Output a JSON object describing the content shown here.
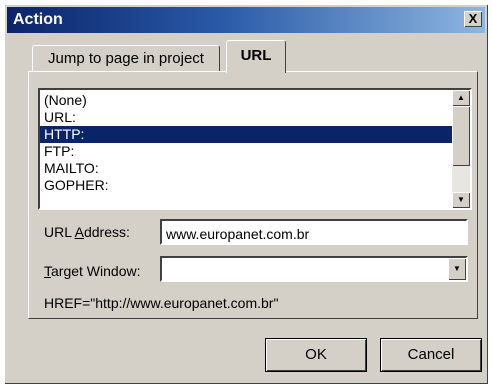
{
  "window": {
    "title": "Action",
    "close_glyph": "X"
  },
  "tabs": [
    {
      "label": "Jump to page in project",
      "active": false
    },
    {
      "label": "URL",
      "active": true
    }
  ],
  "protocol_list": {
    "items": [
      "(None)",
      "URL:",
      "HTTP:",
      "FTP:",
      "MAILTO:",
      "GOPHER:"
    ],
    "selected": "HTTP:"
  },
  "url_address": {
    "label_pre": "URL ",
    "label_u": "A",
    "label_post": "ddress:",
    "value": "www.europanet.com.br"
  },
  "target_window": {
    "label_u": "T",
    "label_post": "arget Window:",
    "value": ""
  },
  "href": "HREF=\"http://www.europanet.com.br\"",
  "buttons": {
    "ok": "OK",
    "cancel": "Cancel"
  },
  "icons": {
    "close": "close-icon",
    "scroll_up": "arrow-up-icon",
    "scroll_down": "arrow-down-icon",
    "dropdown": "chevron-down-icon"
  },
  "colors": {
    "title_start": "#0a246a",
    "title_end": "#8db6e0",
    "selection": "#0a246a",
    "face": "#d4d0c8"
  }
}
